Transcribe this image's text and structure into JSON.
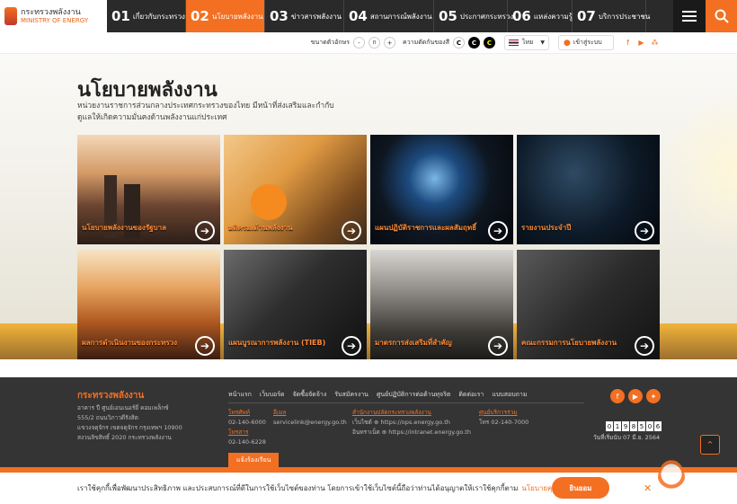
{
  "header": {
    "logo_line1": "กระทรวงพลังงาน",
    "logo_line2": "MINISTRY OF ENERGY",
    "nav": [
      {
        "num": "01",
        "label": "เกี่ยวกับกระทรวง"
      },
      {
        "num": "02",
        "label": "นโยบายพลังงาน"
      },
      {
        "num": "03",
        "label": "ข่าวสารพลังงาน"
      },
      {
        "num": "04",
        "label": "สถานการณ์พลังงาน"
      },
      {
        "num": "05",
        "label": "ประกาศกระทรวง"
      },
      {
        "num": "06",
        "label": "แหล่งความรู้"
      },
      {
        "num": "07",
        "label": "บริการประชาชน"
      }
    ]
  },
  "toolbar": {
    "font_size_label": "ขนาดตัวอักษร",
    "font_minus": "-",
    "font_normal": "ก",
    "font_plus": "+",
    "contrast_label": "ความตัดกันของสี",
    "contrast_btn": "C",
    "language": "ไทย",
    "login": "เข้าสู่ระบบ"
  },
  "page": {
    "title": "นโยบายพลังงาน",
    "description": "หน่วยงานราชการส่วนกลางประเทศกระทรวงของไทย มีหน้าที่ส่งเสริมและกำกับดูแลให้เกิดความมั่นคงด้านพลังงานแก่ประเทศ"
  },
  "cards": [
    {
      "label": "นโยบายพลังงานของรัฐบาล"
    },
    {
      "label": "มติครม.ด้านพลังงาน"
    },
    {
      "label": "แผนปฏิบัติราชการและผลสัมฤทธิ์"
    },
    {
      "label": "รายงานประจำปี"
    },
    {
      "label": "ผลการดำเนินงานของกระทรวง"
    },
    {
      "label": "แผนบูรณาการพลังงาน (TIEB)"
    },
    {
      "label": "มาตรการส่งเสริมที่สำคัญ"
    },
    {
      "label": "คณะกรรมการนโยบายพลังงาน"
    }
  ],
  "footer": {
    "org": "กระทรวงพลังงาน",
    "address": [
      "อาคาร ปี ศูนย์เอนเนอร์ยี่ คอมเพล็กซ์",
      "555/2 ถนนวิภาวดีรังสิต",
      "แขวงจตุจักร เขตจตุจักร กรุงเทพฯ 10900",
      "สงวนลิขสิทธิ์ 2020 กระทรวงพลังงาน"
    ],
    "links": [
      "หน้าแรก",
      "เว็บบอร์ด",
      "จัดซื้อจัดจ้าง",
      "รับสมัครงาน",
      "ศูนย์ปฏิบัติการต่อต้านทุจริต",
      "ติดต่อเรา",
      "แบบสอบถาม"
    ],
    "phone_label": "โทรศัพท์",
    "phone": "02-140-6000",
    "fax_label": "โทรสาร",
    "fax": "02-140-6228",
    "email_label": "อีเมล",
    "email": "servicelink@energy.go.th",
    "office_label": "สำนักงานปลัดกระทรวงพลังงาน",
    "website_label": "เว็บไซต์",
    "website": "https://ops.energy.go.th",
    "intranet_label": "อินทราเน็ต",
    "intranet": "https://intranet.energy.go.th",
    "service_label": "ศูนย์บริการร่วม",
    "service_phone": "โทร 02-140-7000",
    "counter_digits": [
      "0",
      "1",
      "9",
      "8",
      "5",
      "0",
      "6"
    ],
    "since": "วันที่เริ่มนับ 07 มี.ย. 2564",
    "complaint": "แจ้งร้องเรียน"
  },
  "cookie": {
    "text": "เราใช้คุกกี้เพื่อพัฒนาประสิทธิภาพ และประสบการณ์ที่ดีในการใช้เว็บไซต์ของท่าน โดยการเข้าใช้เว็บไซต์นี้ถือว่าท่านได้อนุญาตให้เราใช้คุกกี้ตาม",
    "link": "นโยบายคุกกี้",
    "accept": "ยินยอม"
  },
  "colors": {
    "accent": "#f36f21",
    "topbar": "#2a2a2a",
    "footer": "#343434"
  }
}
